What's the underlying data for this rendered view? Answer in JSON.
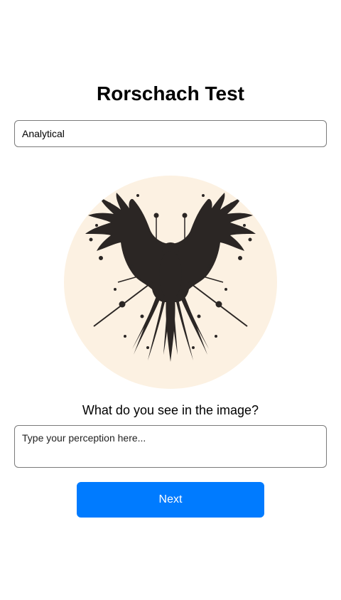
{
  "page": {
    "title": "Rorschach Test",
    "style_select": {
      "selected": "Analytical"
    },
    "image": {
      "icon": "inkblot-image"
    },
    "question": "What do you see in the image?",
    "perception_input": {
      "value": "",
      "placeholder": "Type your perception here..."
    },
    "next_button": {
      "label": "Next"
    }
  },
  "colors": {
    "accent": "#007bff",
    "image_background": "#fcf1e2",
    "ink": "#2b2624"
  }
}
